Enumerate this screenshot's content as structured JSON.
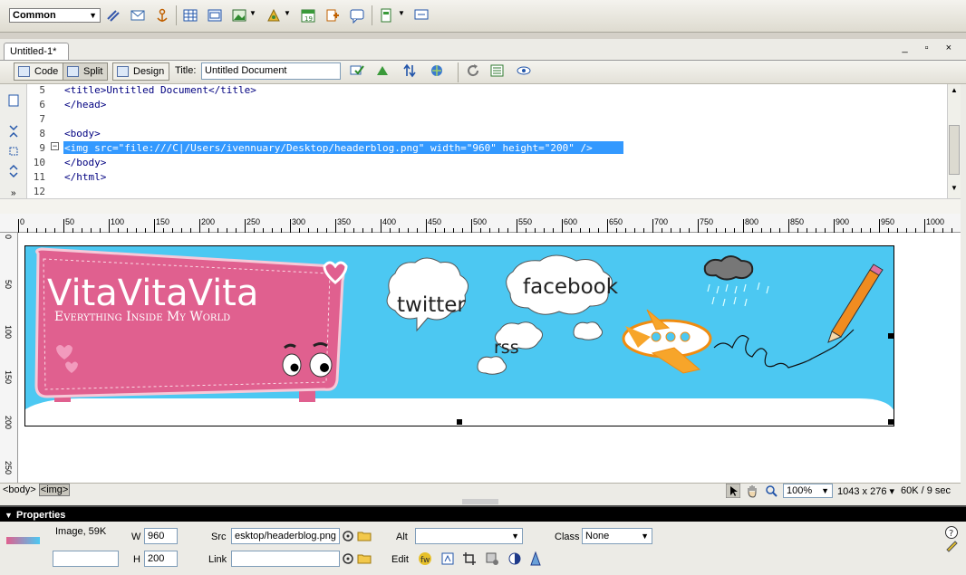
{
  "insert_bar": {
    "category": "Common",
    "icons": [
      "hyperlink-icon",
      "email-link-icon",
      "named-anchor-icon",
      "table-icon",
      "div-icon",
      "images-icon",
      "media-icon",
      "date-icon",
      "server-include-icon",
      "comment-icon",
      "templates-icon",
      "tag-chooser-icon"
    ]
  },
  "document": {
    "tab_label": "Untitled-1*",
    "window_controls": "_ ▫ ×",
    "views": {
      "code": "Code",
      "split": "Split",
      "design": "Design"
    },
    "title_label": "Title:",
    "title_value": "Untitled Document"
  },
  "code": {
    "lines": [
      {
        "num": "5",
        "text": "<title>Untitled Document</title>"
      },
      {
        "num": "6",
        "text": "</head>"
      },
      {
        "num": "7",
        "text": ""
      },
      {
        "num": "8",
        "text": "<body>"
      },
      {
        "num": "9",
        "text": "<img src=\"file:///C|/Users/ivennuary/Desktop/headerblog.png\" width=\"960\" height=\"200\" />"
      },
      {
        "num": "10",
        "text": "</body>"
      },
      {
        "num": "11",
        "text": "</html>"
      },
      {
        "num": "12",
        "text": ""
      }
    ],
    "selected_line": "9"
  },
  "ruler": {
    "labels": [
      "0",
      "50",
      "100",
      "150",
      "200",
      "250",
      "300",
      "350",
      "400",
      "450",
      "500",
      "550",
      "600",
      "650",
      "700",
      "750",
      "800",
      "850",
      "900",
      "950",
      "1000"
    ],
    "left_labels": [
      "0",
      "50",
      "100",
      "150",
      "200",
      "250"
    ]
  },
  "banner": {
    "title": "VitaVitaVita",
    "subtitle": "Everything Inside My World",
    "twitter": "twitter",
    "facebook": "facebook",
    "rss": "rss",
    "colors": {
      "sky": "#4cc8f2",
      "sign": "#e0608f",
      "sign_border": "#f7c9d8"
    }
  },
  "status": {
    "tag_body": "<body>",
    "tag_img": "<img>",
    "zoom": "100%",
    "window_size": "1043 x 276 ▾",
    "download": "60K / 9 sec"
  },
  "properties": {
    "header": "Properties",
    "type": "Image, 59K",
    "w_label": "W",
    "w_value": "960",
    "h_label": "H",
    "h_value": "200",
    "src_label": "Src",
    "src_value": "esktop/headerblog.png",
    "link_label": "Link",
    "link_value": "",
    "alt_label": "Alt",
    "alt_value": "",
    "class_label": "Class",
    "class_value": "None",
    "edit_label": "Edit",
    "id_value": ""
  }
}
